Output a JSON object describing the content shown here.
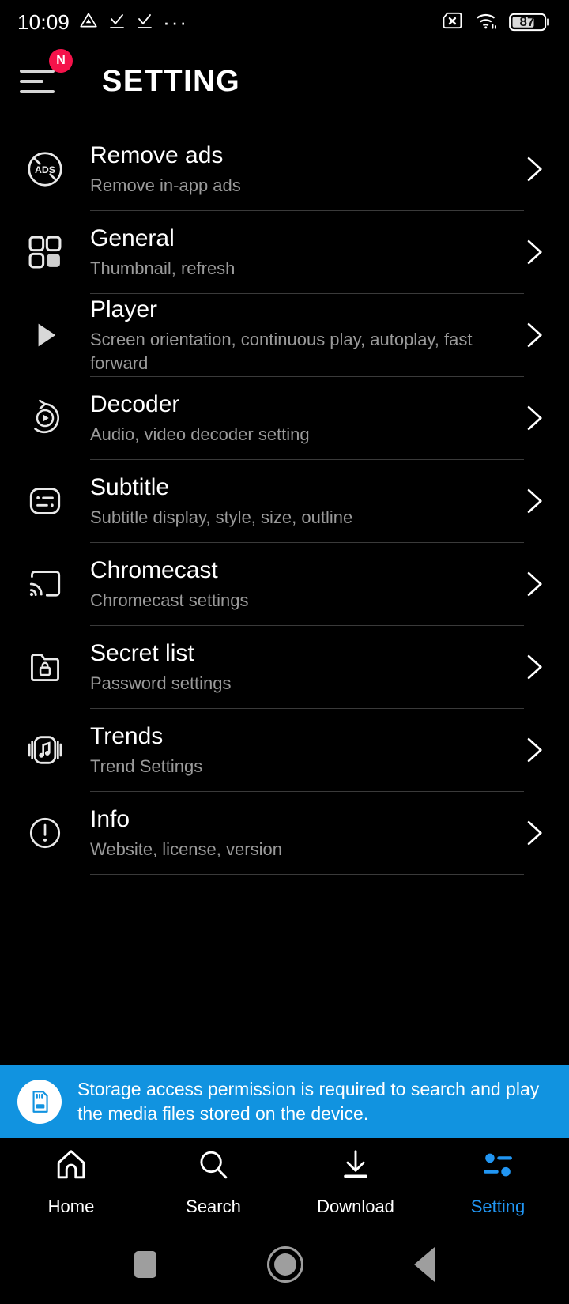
{
  "status_bar": {
    "time": "10:09",
    "left_icons": [
      "warning-triangle-icon",
      "check-download-icon",
      "check-download-icon"
    ],
    "overflow": "···",
    "right_icons": [
      "no-sim-icon",
      "wifi-icon"
    ],
    "battery_level": "87"
  },
  "app_bar": {
    "menu_badge": "N",
    "title": "SETTING"
  },
  "settings": {
    "items": [
      {
        "icon": "no-ads-icon",
        "title": "Remove ads",
        "subtitle": "Remove in-app ads"
      },
      {
        "icon": "grid-icon",
        "title": "General",
        "subtitle": "Thumbnail, refresh"
      },
      {
        "icon": "play-icon",
        "title": "Player",
        "subtitle": "Screen orientation, continuous play, autoplay, fast forward"
      },
      {
        "icon": "decoder-icon",
        "title": "Decoder",
        "subtitle": "Audio, video decoder setting"
      },
      {
        "icon": "subtitle-icon",
        "title": "Subtitle",
        "subtitle": "Subtitle display, style, size, outline"
      },
      {
        "icon": "chromecast-icon",
        "title": "Chromecast",
        "subtitle": "Chromecast settings"
      },
      {
        "icon": "folder-lock-icon",
        "title": "Secret list",
        "subtitle": "Password settings"
      },
      {
        "icon": "music-trend-icon",
        "title": "Trends",
        "subtitle": "Trend Settings"
      },
      {
        "icon": "info-icon",
        "title": "Info",
        "subtitle": "Website, license, version"
      }
    ],
    "chevron": "chevron-right-icon"
  },
  "banner": {
    "icon": "sd-card-icon",
    "message": "Storage access permission is required to search and play the media files stored on the device.",
    "background": "#1193e0"
  },
  "bottom_nav": {
    "active_color": "#2196f3",
    "items": [
      {
        "icon": "home-icon",
        "label": "Home",
        "active": false
      },
      {
        "icon": "search-icon",
        "label": "Search",
        "active": false
      },
      {
        "icon": "download-icon",
        "label": "Download",
        "active": false
      },
      {
        "icon": "sliders-icon",
        "label": "Setting",
        "active": true
      }
    ]
  },
  "system_nav": {
    "items": [
      "recents-square-icon",
      "home-circle-icon",
      "back-triangle-icon"
    ]
  }
}
